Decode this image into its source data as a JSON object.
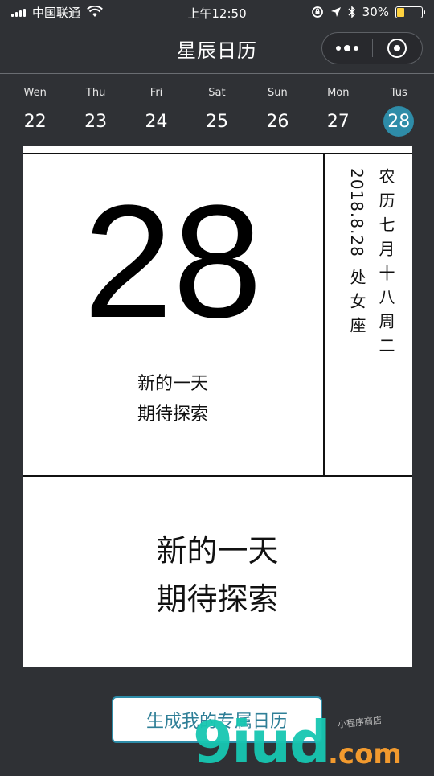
{
  "status_bar": {
    "carrier": "中国联通",
    "time": "上午12:50",
    "battery": "30%",
    "battery_level": 0.3
  },
  "nav": {
    "title": "星辰日历"
  },
  "week": [
    {
      "name": "Wen",
      "num": "22",
      "selected": false
    },
    {
      "name": "Thu",
      "num": "23",
      "selected": false
    },
    {
      "name": "Fri",
      "num": "24",
      "selected": false
    },
    {
      "name": "Sat",
      "num": "25",
      "selected": false
    },
    {
      "name": "Sun",
      "num": "26",
      "selected": false
    },
    {
      "name": "Mon",
      "num": "27",
      "selected": false
    },
    {
      "name": "Tus",
      "num": "28",
      "selected": true
    }
  ],
  "card": {
    "day": "28",
    "quote_line1": "新的一天",
    "quote_line2": "期待探索",
    "lunar": "农历七月十八周二",
    "date": "2018.8.28",
    "sign": "处女座",
    "big_quote_line1": "新的一天",
    "big_quote_line2": "期待探索"
  },
  "button": {
    "label": "生成我的专属日历"
  },
  "watermark": {
    "main": "9iud",
    "suffix": ".com",
    "small": "小程序商店"
  },
  "colors": {
    "background": "#2f3135",
    "accent": "#2e8ca8",
    "card": "#ffffff"
  }
}
